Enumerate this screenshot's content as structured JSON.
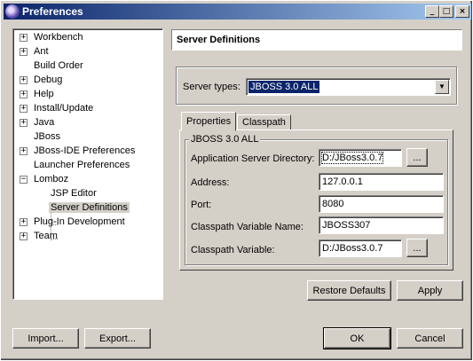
{
  "window": {
    "title": "Preferences",
    "controls": {
      "minimize": "_",
      "maximize": "□",
      "close": "×"
    }
  },
  "tree": {
    "items": [
      {
        "label": "Workbench",
        "expander": "+"
      },
      {
        "label": "Ant",
        "expander": "+"
      },
      {
        "label": "Build Order",
        "expander": ""
      },
      {
        "label": "Debug",
        "expander": "+"
      },
      {
        "label": "Help",
        "expander": "+"
      },
      {
        "label": "Install/Update",
        "expander": "+"
      },
      {
        "label": "Java",
        "expander": "+"
      },
      {
        "label": "JBoss",
        "expander": ""
      },
      {
        "label": "JBoss-IDE Preferences",
        "expander": "+"
      },
      {
        "label": "Launcher Preferences",
        "expander": ""
      },
      {
        "label": "Lomboz",
        "expander": "−"
      },
      {
        "label": "JSP Editor",
        "expander": ""
      },
      {
        "label": "Server Definitions",
        "expander": ""
      },
      {
        "label": "Plug-In Development",
        "expander": "+"
      },
      {
        "label": "Team",
        "expander": "+"
      }
    ],
    "selected": "Server Definitions"
  },
  "page": {
    "title": "Server Definitions",
    "server_types_label": "Server types:",
    "server_types_value": "JBOSS 3.0 ALL",
    "tabs": [
      "Properties",
      "Classpath"
    ],
    "active_tab": "Properties",
    "group_title": "JBOSS 3.0 ALL",
    "fields": [
      {
        "label": "Application Server Directory:",
        "value": "D:/JBoss3.0.7",
        "browse": "..."
      },
      {
        "label": "Address:",
        "value": "127.0.0.1"
      },
      {
        "label": "Port:",
        "value": "8080"
      },
      {
        "label": "Classpath Variable Name:",
        "value": "JBOSS307"
      },
      {
        "label": "Classpath Variable:",
        "value": "D:/JBoss3.0.7",
        "browse": "..."
      }
    ],
    "restore_defaults_label": "Restore Defaults",
    "apply_label": "Apply"
  },
  "footer": {
    "import_label": "Import...",
    "export_label": "Export...",
    "ok_label": "OK",
    "cancel_label": "Cancel"
  }
}
